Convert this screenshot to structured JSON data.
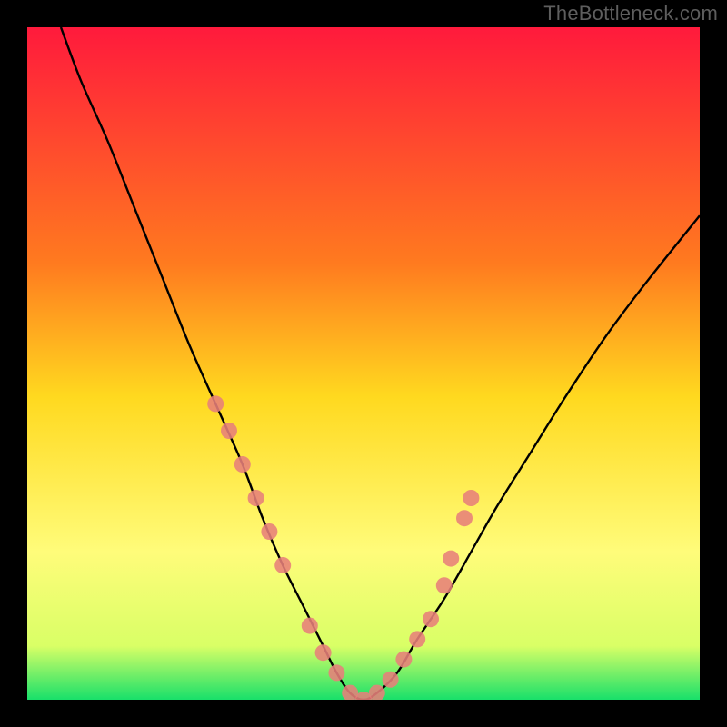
{
  "watermark": "TheBottleneck.com",
  "chart_data": {
    "type": "line",
    "title": "",
    "xlabel": "",
    "ylabel": "",
    "xlim": [
      0,
      100
    ],
    "ylim": [
      0,
      100
    ],
    "gradient_stops": [
      {
        "offset": 0,
        "color": "#ff1a3c"
      },
      {
        "offset": 35,
        "color": "#ff7a1f"
      },
      {
        "offset": 55,
        "color": "#ffd91f"
      },
      {
        "offset": 78,
        "color": "#fffc7a"
      },
      {
        "offset": 92,
        "color": "#d9ff66"
      },
      {
        "offset": 100,
        "color": "#18e06a"
      }
    ],
    "series": [
      {
        "name": "bottleneck-curve",
        "x": [
          5,
          8,
          12,
          16,
          20,
          24,
          28,
          32,
          35,
          38,
          41,
          44,
          46,
          48,
          50,
          52,
          55,
          58,
          62,
          66,
          70,
          75,
          80,
          86,
          92,
          100
        ],
        "y": [
          100,
          92,
          83,
          73,
          63,
          53,
          44,
          35,
          27,
          20,
          14,
          8,
          4,
          1,
          0,
          1,
          4,
          9,
          15,
          22,
          29,
          37,
          45,
          54,
          62,
          72
        ]
      }
    ],
    "markers": {
      "name": "highlight-points",
      "color": "#e77f7a",
      "x": [
        28,
        30,
        32,
        34,
        36,
        38,
        42,
        44,
        46,
        48,
        50,
        52,
        54,
        56,
        58,
        60,
        62,
        63,
        65,
        66
      ],
      "y": [
        44,
        40,
        35,
        30,
        25,
        20,
        11,
        7,
        4,
        1,
        0,
        1,
        3,
        6,
        9,
        12,
        17,
        21,
        27,
        30
      ]
    }
  }
}
